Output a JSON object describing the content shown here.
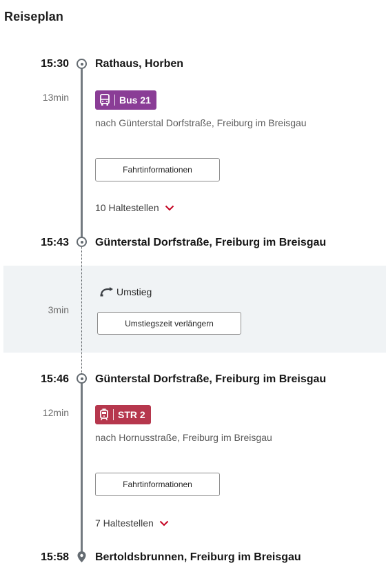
{
  "heading": "Reiseplan",
  "legs": [
    {
      "dep_time": "15:30",
      "dep_station": "Rathaus, Horben",
      "duration": "13min",
      "line": "Bus 21",
      "line_color": "#8a3d96",
      "line_icon": "bus-icon",
      "direction": "nach Günterstal Dorfstraße, Freiburg im Breisgau",
      "info_button": "Fahrtinformationen",
      "stops": "10 Haltestellen",
      "arr_time": "15:43",
      "arr_station": "Günterstal Dorfstraße, Freiburg im Breisgau"
    },
    {
      "dep_time": "15:46",
      "dep_station": "Günterstal Dorfstraße, Freiburg im Breisgau",
      "duration": "12min",
      "line": "STR 2",
      "line_color": "#b6374d",
      "line_icon": "tram-icon",
      "direction": "nach Hornusstraße, Freiburg im Breisgau",
      "info_button": "Fahrtinformationen",
      "stops": "7 Haltestellen",
      "arr_time": "15:58",
      "arr_station": "Bertoldsbrunnen, Freiburg im Breisgau"
    }
  ],
  "transfer": {
    "duration": "3min",
    "label": "Umstieg",
    "button": "Umstiegszeit verlängern"
  },
  "colors": {
    "timeline": "#737a80",
    "transfer_background": "#f0f3f5",
    "chevron": "#c4001f"
  }
}
